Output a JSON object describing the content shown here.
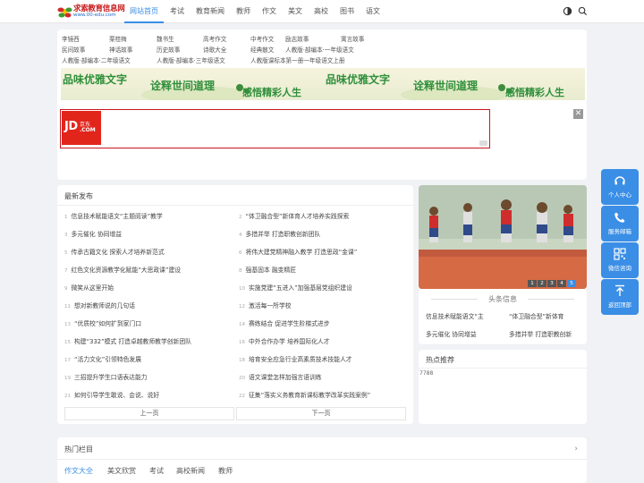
{
  "header": {
    "logo_text": "求索教育信息网",
    "logo_url": "www.00-edu.com",
    "nav": [
      "网站首页",
      "考试",
      "教育新闻",
      "教师",
      "作文",
      "美文",
      "高校",
      "图书",
      "语文"
    ],
    "icons": [
      "theme-toggle-icon",
      "search-icon"
    ]
  },
  "tags": {
    "row1": [
      "李镜西",
      "栗桂梅",
      "魏书生",
      "高考作文",
      "中考作文",
      "励志故事",
      "寓言故事"
    ],
    "row2": [
      "民间故事",
      "神话故事",
      "历史故事",
      "诗歌大全",
      "经典散文",
      "人教版·部编本·一年级语文"
    ],
    "row3": [
      "人教版·部编本·二年级语文",
      "人教版·部编本·三年级语文",
      "人教版课标本第一册一年级语文上册"
    ]
  },
  "banner": {
    "phrases": [
      "品味优雅文字",
      "诠释世间道理",
      "感悟精彩人生",
      "品味优雅文字",
      "诠释世间道理",
      "感悟精彩人生"
    ]
  },
  "ad": {
    "brand_jd": "JD",
    "brand_cn": "京东",
    "brand_com": ".COM",
    "close": "✕"
  },
  "latest": {
    "title": "最新发布",
    "posts": [
      {
        "n": "1",
        "t": "信息技术赋能语文“主题阅读”教学"
      },
      {
        "n": "2",
        "t": "“体卫融合型”新体育人才培养实践探索"
      },
      {
        "n": "3",
        "t": "多元催化 协同增益"
      },
      {
        "n": "4",
        "t": "多措并举 打造职教创新团队"
      },
      {
        "n": "5",
        "t": "传承古籍文化 探索人才培养新范式"
      },
      {
        "n": "6",
        "t": "将伟大建党精神融入教学 打造思政“金课”"
      },
      {
        "n": "7",
        "t": "红色文化资源教学化赋能“大思政课”建设"
      },
      {
        "n": "8",
        "t": "强基固本 融变精匠"
      },
      {
        "n": "9",
        "t": "微笑从这里开始"
      },
      {
        "n": "10",
        "t": "实施党建“五进入”加强基层党组织建设"
      },
      {
        "n": "11",
        "t": "想对新教师说的几句话"
      },
      {
        "n": "12",
        "t": "激活每一所学校"
      },
      {
        "n": "13",
        "t": "“优质校”如何扩到家门口"
      },
      {
        "n": "14",
        "t": "赛练结合 促进学生阶梯式进步"
      },
      {
        "n": "15",
        "t": "构建“332”模式 打造卓越教师教学创新团队"
      },
      {
        "n": "16",
        "t": "中外合作办学 培养国际化人才"
      },
      {
        "n": "17",
        "t": "“活力文化”引领特色发展"
      },
      {
        "n": "18",
        "t": "培育安全应急行业高素质技术技能人才"
      },
      {
        "n": "19",
        "t": "三招提升学生口语表达能力"
      },
      {
        "n": "20",
        "t": "语文课堂怎样加强言语训练"
      },
      {
        "n": "21",
        "t": "如何引导学生敢说、会说、说好"
      },
      {
        "n": "22",
        "t": "征集“落实义务教育新课标教学改革实践案例”"
      }
    ],
    "prev": "上一页",
    "next": "下一页"
  },
  "slider": {
    "pages": [
      "1",
      "2",
      "3",
      "4",
      "5"
    ],
    "active": 5
  },
  "headlines": {
    "title": "头条信息",
    "items": [
      "信息技术赋能语文“主",
      "“体卫融合型”新体育",
      "多元催化 协同增益",
      "多措并举 打造职教创新"
    ]
  },
  "hot": {
    "title": "热点推荐",
    "value": "7788"
  },
  "columns": {
    "title": "热门栏目",
    "tabs": [
      "作文大全",
      "美文欣赏",
      "考试",
      "高校新闻",
      "教师"
    ]
  },
  "side": [
    "个人中心",
    "服务邮箱",
    "微信咨询",
    "返回顶部"
  ],
  "colors": {
    "accent": "#3a8ee6",
    "banner_green": "#2f8f3a",
    "ad_red": "#c8161d"
  }
}
